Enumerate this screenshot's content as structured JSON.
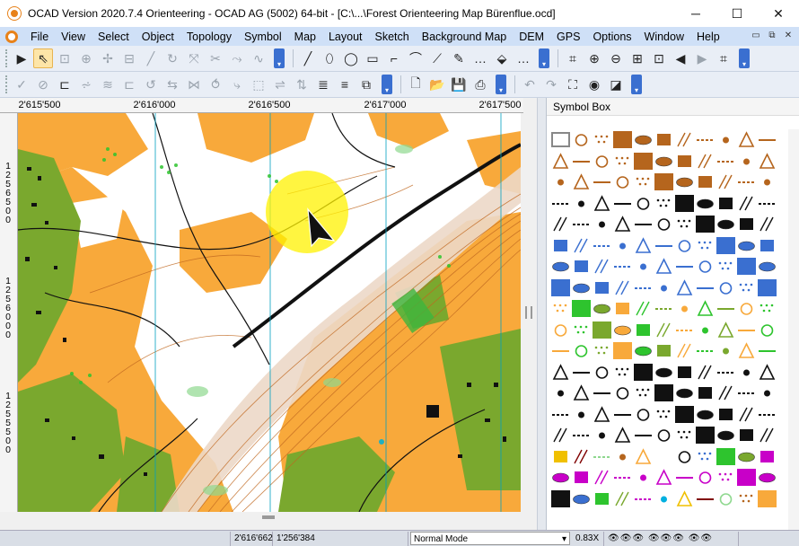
{
  "window": {
    "title": "OCAD Version 2020.7.4 Orienteering - OCAD AG (5002) 64-bit - [C:\\...\\Forest Orienteering Map Bürenflue.ocd]",
    "controls": [
      "─",
      "☐",
      "✕"
    ]
  },
  "menu": {
    "items": [
      "File",
      "View",
      "Select",
      "Object",
      "Topology",
      "Symbol",
      "Map",
      "Layout",
      "Sketch",
      "Background Map",
      "DEM",
      "GPS",
      "Options",
      "Window",
      "Help"
    ],
    "mdi_controls": [
      "▭",
      "⧉",
      "✕"
    ]
  },
  "toolbar1": {
    "tools": [
      {
        "name": "pointer",
        "glyph": "▶",
        "active": false
      },
      {
        "name": "edit-object",
        "glyph": "⇖",
        "active": true
      },
      {
        "name": "edit-point",
        "glyph": "⊡",
        "dim": true
      },
      {
        "name": "move-point",
        "glyph": "⊕",
        "dim": true
      },
      {
        "name": "add-point",
        "glyph": "✢",
        "dim": true
      },
      {
        "name": "delete-point",
        "glyph": "⊟",
        "dim": true
      },
      {
        "name": "cut",
        "glyph": "╱",
        "dim": true
      },
      {
        "name": "rotate",
        "glyph": "↻",
        "dim": true
      },
      {
        "name": "stretch",
        "glyph": "⤧",
        "dim": true
      },
      {
        "name": "scissors",
        "glyph": "✂",
        "dim": true
      },
      {
        "name": "join",
        "glyph": "⤳",
        "dim": true
      },
      {
        "name": "smooth",
        "glyph": "∿",
        "dim": true
      },
      {
        "name": "line-mode",
        "glyph": "╱",
        "active": false
      },
      {
        "name": "ellipse-mode",
        "glyph": "⬯",
        "active": false
      },
      {
        "name": "circle-mode",
        "glyph": "◯",
        "active": false
      },
      {
        "name": "rect-mode",
        "glyph": "▭",
        "active": false
      },
      {
        "name": "step-mode",
        "glyph": "⌐",
        "active": false
      },
      {
        "name": "curve-mode",
        "glyph": "⌒",
        "active": false
      },
      {
        "name": "path-mode",
        "glyph": "⟋",
        "active": false
      },
      {
        "name": "freehand",
        "glyph": "✎",
        "active": false
      },
      {
        "name": "more",
        "glyph": "…",
        "active": false
      },
      {
        "name": "fill",
        "glyph": "⬙",
        "active": false
      },
      {
        "name": "numbering",
        "glyph": "…",
        "active": false
      },
      {
        "name": "binoculars",
        "glyph": "⌗",
        "active": false
      },
      {
        "name": "zoom-in",
        "glyph": "⊕",
        "active": false
      },
      {
        "name": "zoom-out",
        "glyph": "⊖",
        "active": false
      },
      {
        "name": "zoom-window",
        "glyph": "⊞",
        "active": false
      },
      {
        "name": "zoom-object",
        "glyph": "⊡",
        "active": false
      },
      {
        "name": "back",
        "glyph": "◀",
        "active": false
      },
      {
        "name": "forward",
        "glyph": "▶",
        "dim": true
      },
      {
        "name": "grid",
        "glyph": "⌗",
        "active": false
      }
    ]
  },
  "toolbar2": {
    "tools": [
      {
        "name": "check",
        "glyph": "✓",
        "dim": true
      },
      {
        "name": "cancel",
        "glyph": "⊘",
        "dim": true
      },
      {
        "name": "crop",
        "glyph": "⊏",
        "dim": false
      },
      {
        "name": "tool-a",
        "glyph": "⩫",
        "dim": true
      },
      {
        "name": "tool-b",
        "glyph": "≋",
        "dim": true
      },
      {
        "name": "tool-c",
        "glyph": "⊏",
        "dim": true
      },
      {
        "name": "tool-d",
        "glyph": "↺",
        "dim": true
      },
      {
        "name": "tool-e",
        "glyph": "⇆",
        "dim": true
      },
      {
        "name": "tool-f",
        "glyph": "⋈",
        "dim": true
      },
      {
        "name": "tool-g",
        "glyph": "⥀",
        "dim": true
      },
      {
        "name": "tool-h",
        "glyph": "⤷",
        "dim": true
      },
      {
        "name": "tool-i",
        "glyph": "⬚",
        "dim": true
      },
      {
        "name": "tool-j",
        "glyph": "⇌",
        "dim": true
      },
      {
        "name": "tool-k",
        "glyph": "⇅",
        "dim": true
      },
      {
        "name": "tool-l",
        "glyph": "≣",
        "dim": false
      },
      {
        "name": "tool-m",
        "glyph": "≡",
        "dim": false
      },
      {
        "name": "layers",
        "glyph": "⧉",
        "dim": false
      },
      {
        "name": "new",
        "glyph": "🗋",
        "dim": false
      },
      {
        "name": "open",
        "glyph": "📂",
        "dim": false
      },
      {
        "name": "save",
        "glyph": "💾",
        "dim": false
      },
      {
        "name": "print",
        "glyph": "⎙",
        "dim": false
      },
      {
        "name": "undo",
        "glyph": "↶",
        "dim": true
      },
      {
        "name": "redo",
        "glyph": "↷",
        "dim": true
      },
      {
        "name": "fullscreen",
        "glyph": "⛶",
        "dim": false
      },
      {
        "name": "preview",
        "glyph": "◉",
        "dim": false
      },
      {
        "name": "color-tool",
        "glyph": "◪",
        "dim": false
      }
    ]
  },
  "ruler": {
    "x_labels": [
      "2'615'500",
      "2'616'000",
      "2'616'500",
      "2'617'000",
      "2'617'500"
    ],
    "y_labels": [
      "1256500",
      "1256000",
      "1255500"
    ]
  },
  "symbolbox": {
    "title": "Symbol Box"
  },
  "status": {
    "coord_x": "2'616'662",
    "coord_y": "1'256'384",
    "mode": "Normal Mode",
    "zoom": "0.83X"
  },
  "colors": {
    "map_yellow": "#f8a93b",
    "map_green": "#7aa82e",
    "map_brown": "#b5651d",
    "accent": "#3a6fd0",
    "cursor_highlight": "#fff200"
  }
}
